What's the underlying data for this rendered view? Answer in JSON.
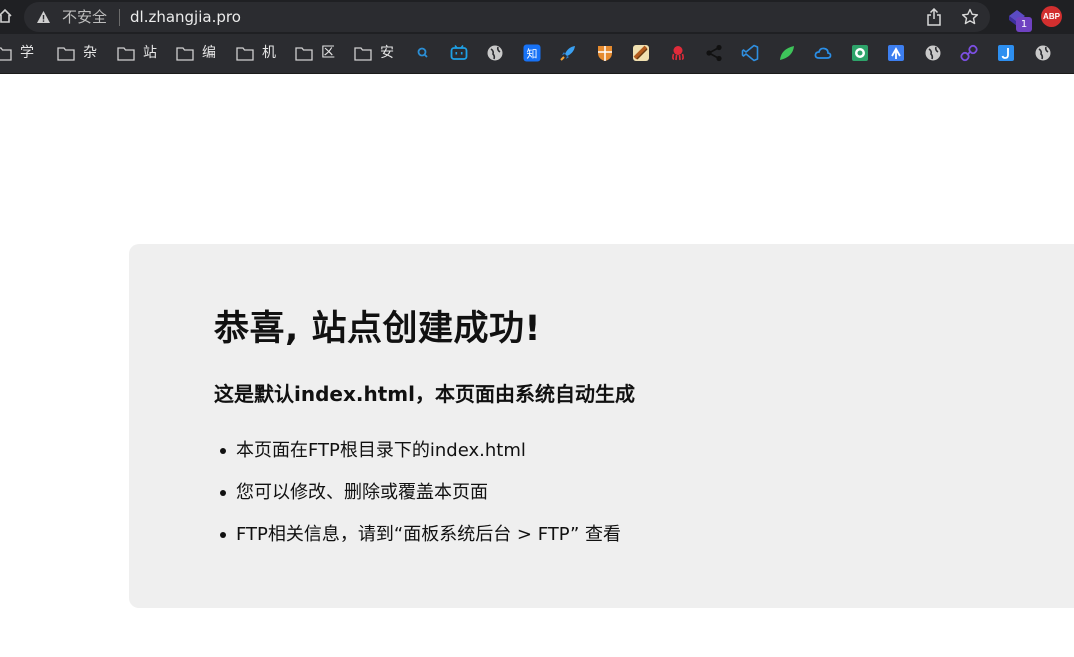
{
  "browser": {
    "security_label": "不安全",
    "url": "dl.zhangjia.pro",
    "extension_badge": "1",
    "abp_label": "ABP"
  },
  "bookmarks": {
    "folders": [
      "学",
      "杂",
      "站",
      "编",
      "机",
      "区",
      "安"
    ],
    "icons": [
      "search-icon",
      "bilibili-icon",
      "globe-icon",
      "zhihu-icon",
      "rocket-icon",
      "crest-icon",
      "badge-icon",
      "octopus-icon",
      "share-nodes-icon",
      "vscode-icon",
      "leaf-icon",
      "cloud-icon",
      "lock-shield-icon",
      "translate-icon",
      "globe-icon",
      "link-icon",
      "j-icon",
      "globe-icon"
    ],
    "zhihu_label": "知"
  },
  "page": {
    "title": "恭喜, 站点创建成功!",
    "subtitle": "这是默认index.html，本页面由系统自动生成",
    "items": [
      "本页面在FTP根目录下的index.html",
      "您可以修改、删除或覆盖本页面",
      "FTP相关信息，请到“面板系统后台 > FTP” 查看"
    ]
  },
  "colors": {
    "topbar": "#1f2023",
    "omnibox": "#2b2c30",
    "card_background": "#efefef",
    "text": "#111111"
  }
}
